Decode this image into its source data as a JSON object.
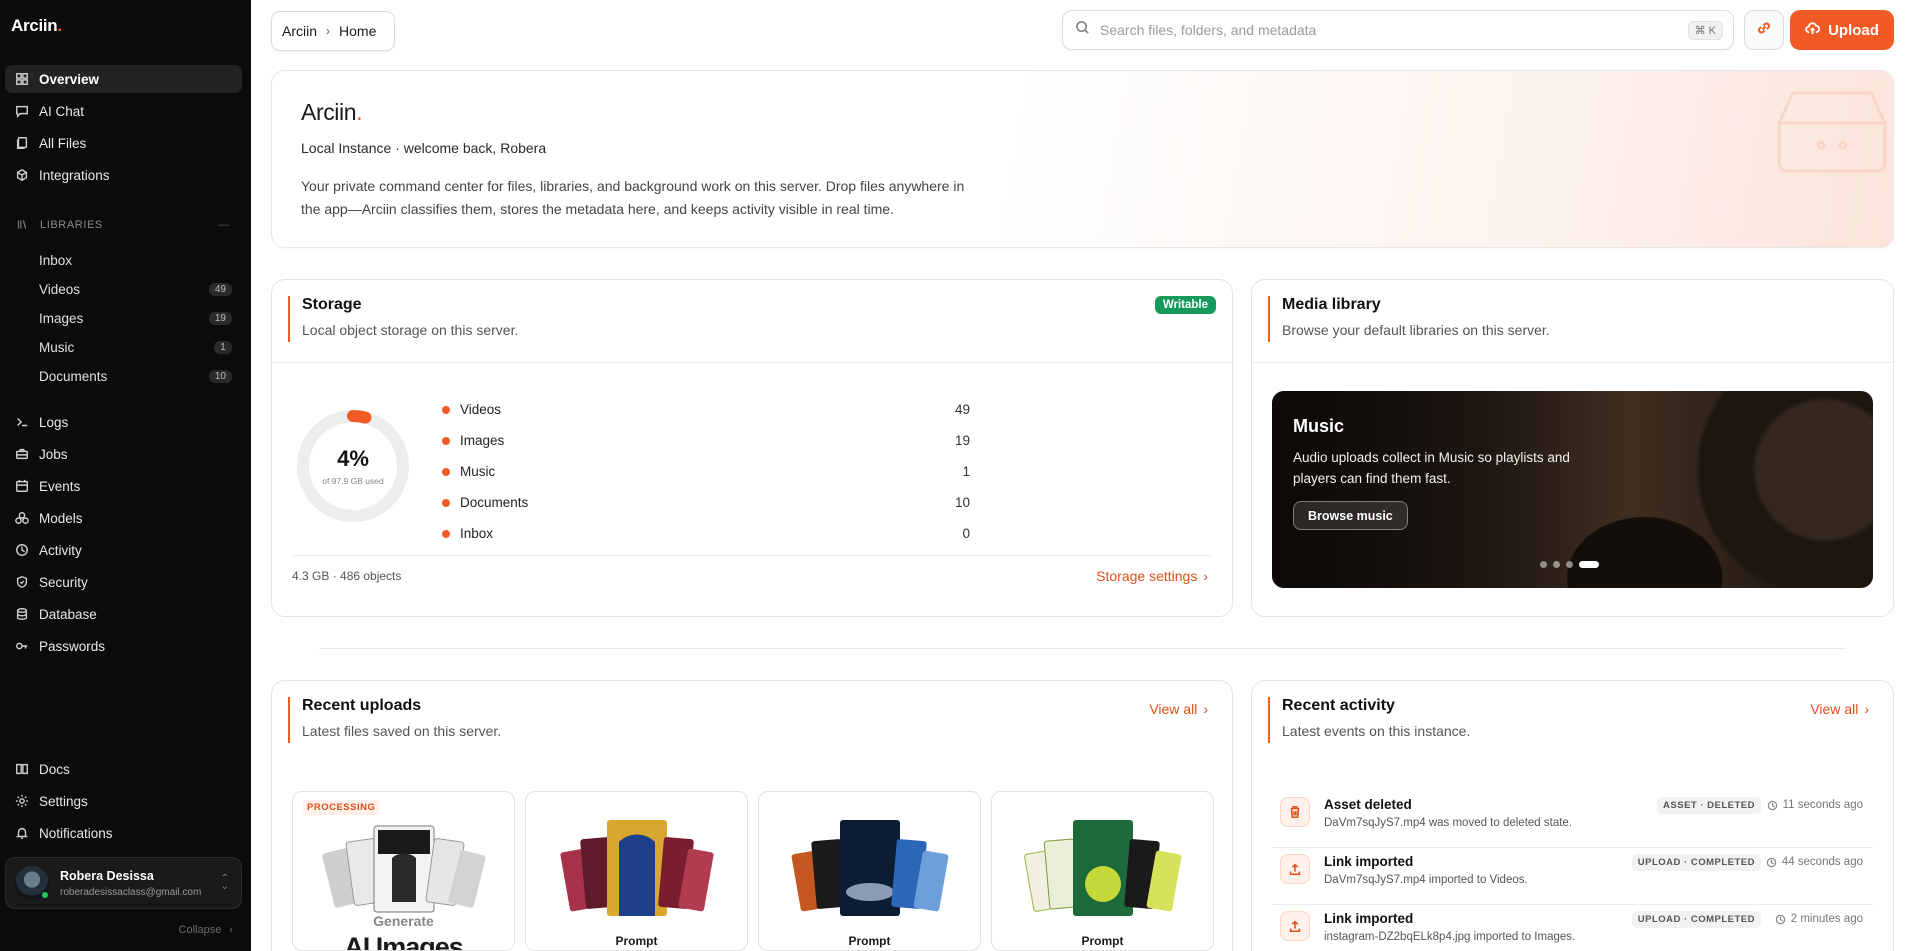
{
  "brand": {
    "name": "Arciin",
    "dot": "."
  },
  "sidebar": {
    "nav": [
      {
        "label": "Overview",
        "icon": "grid-icon"
      },
      {
        "label": "AI Chat",
        "icon": "chat-icon"
      },
      {
        "label": "All Files",
        "icon": "files-icon"
      },
      {
        "label": "Integrations",
        "icon": "plug-icon"
      }
    ],
    "libraries_label": "LIBRARIES",
    "libraries_toggle": "—",
    "libraries": [
      {
        "label": "Inbox",
        "count": ""
      },
      {
        "label": "Videos",
        "count": "49"
      },
      {
        "label": "Images",
        "count": "19"
      },
      {
        "label": "Music",
        "count": "1"
      },
      {
        "label": "Documents",
        "count": "10"
      }
    ],
    "tools": [
      {
        "label": "Logs",
        "icon": "terminal-icon"
      },
      {
        "label": "Jobs",
        "icon": "briefcase-icon"
      },
      {
        "label": "Events",
        "icon": "calendar-icon"
      },
      {
        "label": "Models",
        "icon": "models-icon"
      },
      {
        "label": "Activity",
        "icon": "activity-icon"
      },
      {
        "label": "Security",
        "icon": "shield-icon"
      },
      {
        "label": "Database",
        "icon": "database-icon"
      },
      {
        "label": "Passwords",
        "icon": "key-icon"
      }
    ],
    "bottom": [
      {
        "label": "Docs",
        "icon": "book-icon"
      },
      {
        "label": "Settings",
        "icon": "gear-icon"
      },
      {
        "label": "Notifications",
        "icon": "bell-icon"
      }
    ],
    "user": {
      "name": "Robera Desissa",
      "email": "roberadesissaclass@gmail.com"
    },
    "collapse_label": "Collapse"
  },
  "topbar": {
    "breadcrumb": [
      "Arciin",
      "Home"
    ],
    "search_placeholder": "Search files, folders, and metadata",
    "shortcut": "⌘ K",
    "upload_label": "Upload"
  },
  "hero": {
    "title": "Arciin",
    "subtitle": "Local Instance · welcome back, Robera",
    "description": "Your private command center for files, libraries, and background work on this server. Drop files anywhere in the app—Arciin classifies them, stores the metadata here, and keeps activity visible in real time."
  },
  "storage": {
    "title": "Storage",
    "subtitle": "Local object storage on this server.",
    "badge": "Writable",
    "percent_label": "4%",
    "of_label": "of 97.9 GB used",
    "used_fraction": 0.04,
    "items": [
      {
        "label": "Videos",
        "value": "49"
      },
      {
        "label": "Images",
        "value": "19"
      },
      {
        "label": "Music",
        "value": "1"
      },
      {
        "label": "Documents",
        "value": "10"
      },
      {
        "label": "Inbox",
        "value": "0"
      }
    ],
    "meta": "4.3 GB · 486 objects",
    "settings_link": "Storage settings"
  },
  "media": {
    "title": "Media library",
    "subtitle": "Browse your default libraries on this server.",
    "banner_title": "Music",
    "banner_desc": "Audio uploads collect in Music so playlists and players can find them fast.",
    "banner_button": "Browse music",
    "slide_count": 4,
    "active_slide": 4
  },
  "uploads": {
    "title": "Recent uploads",
    "subtitle": "Latest files saved on this server.",
    "view_all": "View all",
    "tiles": [
      {
        "badge": "PROCESSING",
        "caption_small": "Generate",
        "caption": "AI Images"
      },
      {
        "badge": "",
        "caption_small": "",
        "caption": "Prompt"
      },
      {
        "badge": "",
        "caption_small": "",
        "caption": "Prompt"
      },
      {
        "badge": "",
        "caption_small": "",
        "caption": "Prompt"
      }
    ],
    "accent": "#f15a24"
  },
  "activity": {
    "title": "Recent activity",
    "subtitle": "Latest events on this instance.",
    "view_all": "View all",
    "items": [
      {
        "title": "Asset deleted",
        "desc": "DaVm7sqJyS7.mp4 was moved to deleted state.",
        "tag": "ASSET · DELETED",
        "time": "11 seconds ago",
        "icon": "trash-icon"
      },
      {
        "title": "Link imported",
        "desc": "DaVm7sqJyS7.mp4 imported to Videos.",
        "tag": "UPLOAD · COMPLETED",
        "time": "44 seconds ago",
        "icon": "upload-icon"
      },
      {
        "title": "Link imported",
        "desc": "instagram-DZ2bqELk8p4.jpg imported to Images.",
        "tag": "UPLOAD · COMPLETED",
        "time": "2 minutes ago",
        "icon": "upload-icon"
      }
    ]
  }
}
